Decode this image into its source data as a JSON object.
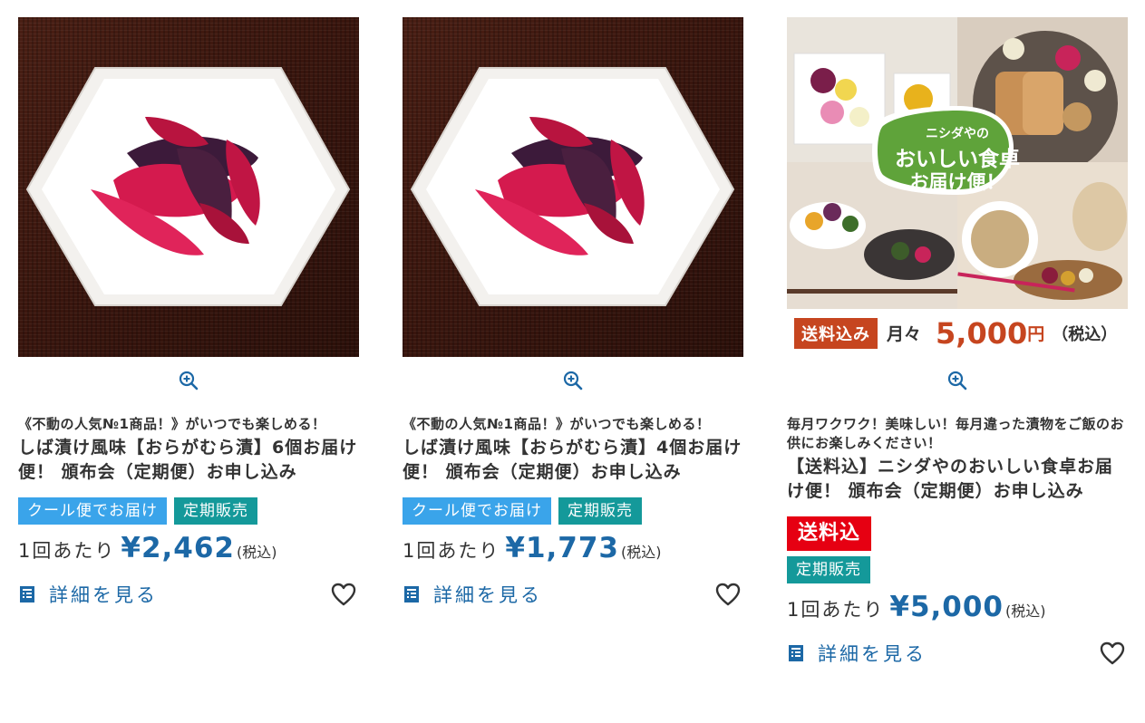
{
  "products": [
    {
      "catch": "《不動の人気№1商品！》がいつでも楽しめる！",
      "name": "しば漬け風味【おらがむら漬】6個お届け便！ 頒布会（定期便）お申し込み",
      "tags": [
        "クール便でお届け",
        "定期販売"
      ],
      "price_prefix": "1回あたり",
      "price": "¥2,462",
      "tax": "(税込)",
      "detail_label": "詳細を見る"
    },
    {
      "catch": "《不動の人気№1商品！》がいつでも楽しめる！",
      "name": "しば漬け風味【おらがむら漬】4個お届け便！ 頒布会（定期便）お申し込み",
      "tags": [
        "クール便でお届け",
        "定期販売"
      ],
      "price_prefix": "1回あたり",
      "price": "¥1,773",
      "tax": "(税込)",
      "detail_label": "詳細を見る"
    },
    {
      "catch": "毎月ワクワク！美味しい！毎月違った漬物をご飯のお供にお楽しみください！",
      "name": "【送料込】ニシダやのおいしい食卓お届け便！ 頒布会（定期便）お申し込み",
      "tags": [
        "送料込",
        "定期販売"
      ],
      "price_prefix": "1回あたり",
      "price": "¥5,000",
      "tax": "(税込)",
      "detail_label": "詳細を見る",
      "image_badge": {
        "line1": "ニシダやの",
        "line2": "おいしい食卓",
        "line3": "お届け便！"
      },
      "image_banner": {
        "pill": "送料込み",
        "monthly": "月々",
        "amount": "5,000",
        "yen": "円",
        "incl": "（税込）"
      }
    }
  ],
  "icons": [
    "zoom-in-icon",
    "detail-document-icon",
    "heart-icon"
  ],
  "colors": {
    "price_blue": "#1c68a6",
    "tag_blue": "#3aa4ea",
    "tag_teal": "#14999a",
    "tag_red": "#e60012",
    "banner_red": "#c6451f"
  }
}
